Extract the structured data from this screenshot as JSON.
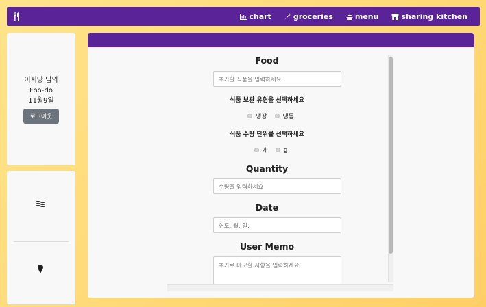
{
  "nav": {
    "chart": "chart",
    "groceries": "groceries",
    "menu": "menu",
    "sharing": "sharing kitchen"
  },
  "profile": {
    "greeting": "이지망 님의",
    "app": "Foo-do",
    "date": "11월9일",
    "logout": "로그아웃"
  },
  "form": {
    "food_label": "Food",
    "food_placeholder": "추가할 식품을 입력하세요",
    "storage_label": "식품 보관 유형을 선택하세요",
    "storage_options": [
      "냉장",
      "냉동"
    ],
    "unit_label": "식품 수량 단위를 선택하세요",
    "unit_options": [
      "개",
      "g"
    ],
    "quantity_label": "Quantity",
    "quantity_placeholder": "수량을 입력하세요",
    "date_label": "Date",
    "date_placeholder": "연도. 월. 일.",
    "memo_label": "User Memo",
    "memo_placeholder": "추가로 메모할 사항을 입력하세요"
  },
  "colors": {
    "brand": "#5b2398",
    "background": "#ffd976"
  }
}
